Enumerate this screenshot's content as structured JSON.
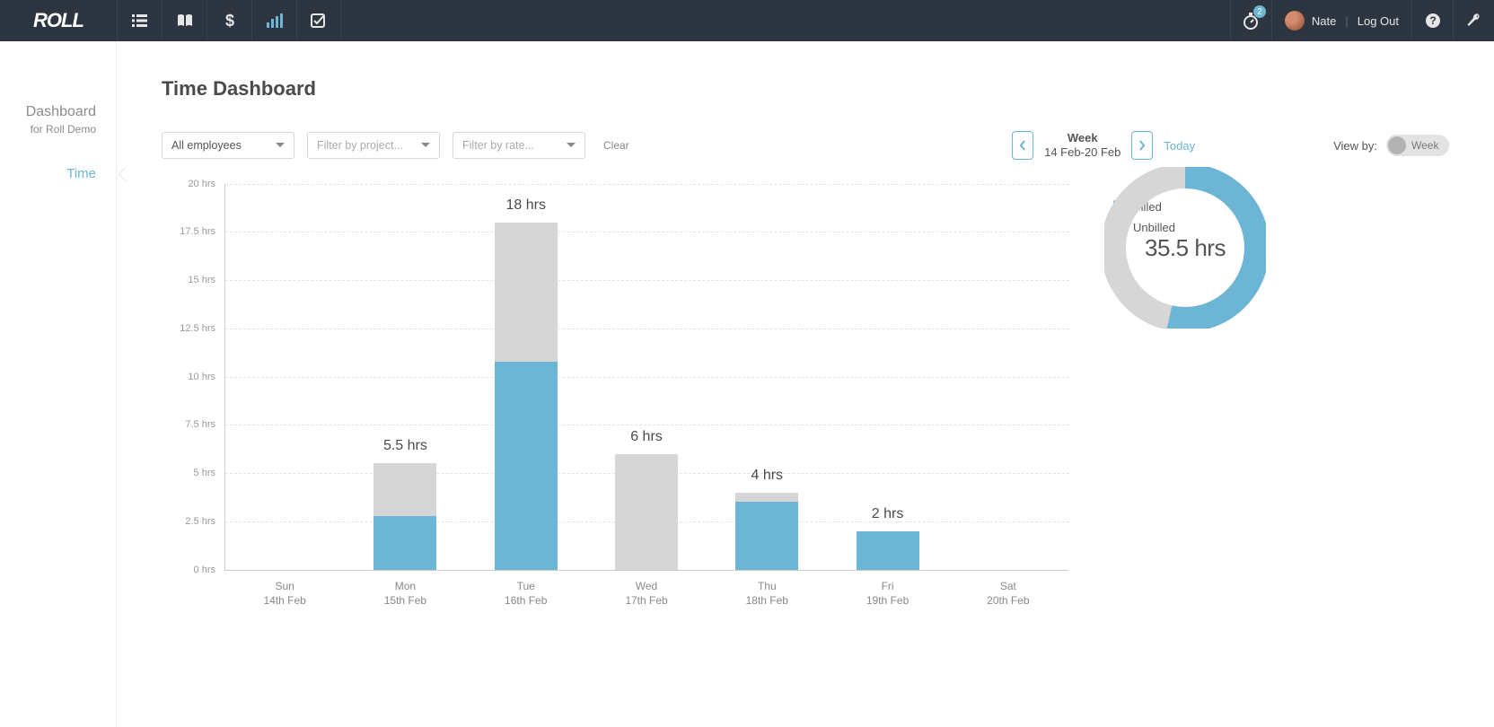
{
  "topbar": {
    "logo_text": "ROLL",
    "timer_badge": "2",
    "username": "Nate",
    "logout": "Log Out"
  },
  "sidebar": {
    "title": "Dashboard",
    "subtitle": "for Roll Demo",
    "active": "Time"
  },
  "page": {
    "title": "Time Dashboard"
  },
  "filters": {
    "employees": "All employees",
    "project_placeholder": "Filter by project...",
    "rate_placeholder": "Filter by rate...",
    "clear": "Clear"
  },
  "datebar": {
    "line1": "Week",
    "line2": "14 Feb-20 Feb",
    "today": "Today",
    "viewby_label": "View by:",
    "toggle_label": "Week"
  },
  "legend": [
    "Billed",
    "Unbilled"
  ],
  "donut": {
    "total_label": "35.5 hrs"
  },
  "chart_data": {
    "type": "bar",
    "ylabel": "hrs",
    "ylim": [
      0,
      20
    ],
    "yticks": [
      0,
      2.5,
      5,
      7.5,
      10,
      12.5,
      15,
      17.5,
      20
    ],
    "ytick_labels": [
      "0 hrs",
      "2.5 hrs",
      "5 hrs",
      "7.5 hrs",
      "10 hrs",
      "12.5 hrs",
      "15 hrs",
      "17.5 hrs",
      "20 hrs"
    ],
    "categories": [
      "Sun",
      "Mon",
      "Tue",
      "Wed",
      "Thu",
      "Fri",
      "Sat"
    ],
    "category_sub": [
      "14th Feb",
      "15th Feb",
      "16th Feb",
      "17th Feb",
      "18th Feb",
      "19th Feb",
      "20th Feb"
    ],
    "series": [
      {
        "name": "Billed",
        "values": [
          0,
          2.75,
          10.75,
          0,
          3.5,
          2,
          0
        ]
      },
      {
        "name": "Unbilled",
        "values": [
          0,
          2.75,
          7.25,
          6,
          0.5,
          0,
          0
        ]
      }
    ],
    "bar_labels": [
      "",
      "5.5 hrs",
      "18 hrs",
      "6 hrs",
      "4 hrs",
      "2 hrs",
      ""
    ],
    "totals": [
      0,
      5.5,
      18,
      6,
      4,
      2,
      0
    ],
    "grand_total": 35.5
  },
  "colors": {
    "billed": "#6cb5d4",
    "unbilled": "#d6d6d6"
  }
}
